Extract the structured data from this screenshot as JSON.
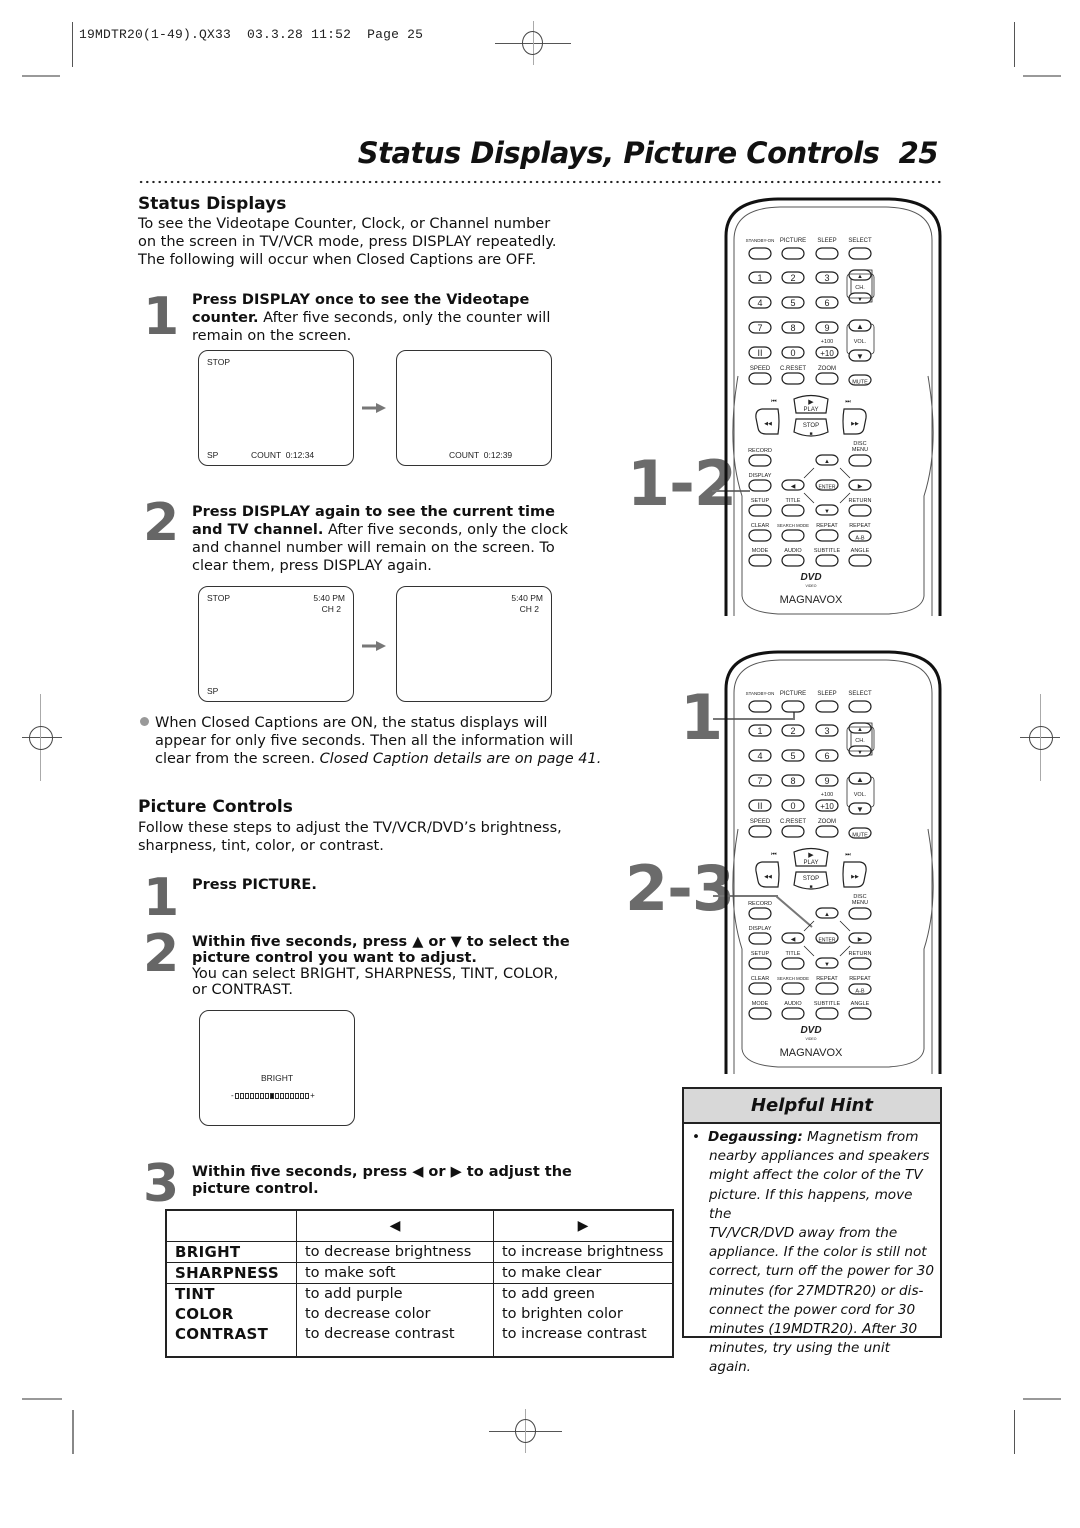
{
  "slug": {
    "file": "19MDTR20(1-49).QX33",
    "date": "03.3.28",
    "time": "11:52",
    "page_label": "Page 25"
  },
  "page_title": "Status Displays, Picture Controls",
  "page_number": "25",
  "status_displays": {
    "heading": "Status Displays",
    "intro": [
      "To see the Videotape Counter, Clock, or Channel number",
      "on the screen in TV/VCR mode, press DISPLAY repeatedly.",
      "The following will occur when Closed Captions are OFF."
    ],
    "step1": {
      "number": "1",
      "bold": "Press DISPLAY once to see the Videotape",
      "bold2": "counter.",
      "text": " After five seconds, only the counter will",
      "text2": "remain on the screen."
    },
    "screens1": {
      "before": {
        "top_left": "STOP",
        "bottom_left": "SP",
        "bottom_center": "COUNT  0:12:34"
      },
      "after": {
        "bottom_center": "COUNT  0:12:39"
      }
    },
    "step2": {
      "number": "2",
      "bold": "Press DISPLAY again to see the current time",
      "bold2": "and TV channel.",
      "text": " After five seconds, only the clock",
      "text2": "and channel number will remain on the screen. To",
      "text3": "clear them, press DISPLAY again."
    },
    "screens2": {
      "before": {
        "top_left": "STOP",
        "time": "5:40 PM",
        "channel": "CH 2",
        "bottom_left": "SP"
      },
      "after": {
        "time": "5:40 PM",
        "channel": "CH 2"
      }
    },
    "note": {
      "line1": "When Closed Captions are ON, the status displays will",
      "line2": "appear for only five seconds. Then all the information will",
      "line3": "clear from the screen. ",
      "italic": "Closed Caption details are on page 41."
    }
  },
  "picture_controls": {
    "heading": "Picture Controls",
    "intro": [
      "Follow these steps to adjust the TV/VCR/DVD’s brightness,",
      "sharpness, tint, color, or contrast."
    ],
    "step1": {
      "number": "1",
      "bold": "Press PICTURE."
    },
    "step2": {
      "number": "2",
      "bold": "Within five seconds, press ▲ or ▼ to select the",
      "bold2": "picture control you want to adjust.",
      "text": "You can select BRIGHT, SHARPNESS, TINT, COLOR,",
      "text2": "or CONTRAST."
    },
    "screen": {
      "label": "BRIGHT",
      "bar": "-▯▯▯▯▯▯▯■▯▯▯▯▯▯▯+",
      "level_fraction": 0.5
    },
    "step3": {
      "number": "3",
      "bold": "Within five seconds, press ◀ or ▶ to adjust the",
      "bold2": "picture control."
    },
    "table": {
      "headers": [
        "",
        "◀",
        "▶"
      ],
      "rows": [
        [
          "BRIGHT",
          "to decrease brightness",
          "to increase brightness"
        ],
        [
          "SHARPNESS",
          "to make soft",
          "to make clear"
        ],
        [
          "TINT",
          "to add purple",
          "to add green"
        ],
        [
          "COLOR",
          "to decrease color",
          "to brighten color"
        ],
        [
          "CONTRAST",
          "to decrease contrast",
          "to increase contrast"
        ]
      ]
    }
  },
  "remote_callouts": {
    "top": "1-2",
    "middle": "1",
    "bottom": "2-3"
  },
  "remote": {
    "top_row_labels": [
      "STANDBY-ON",
      "PICTURE",
      "SLEEP",
      "SELECT"
    ],
    "digits": [
      "1",
      "2",
      "3",
      "4",
      "5",
      "6",
      "7",
      "8",
      "9",
      "II",
      "0",
      "+10"
    ],
    "plus100": "+100",
    "ch_label": "CH.",
    "vol_label": "VOL.",
    "row_labels": [
      "SPEED",
      "C.RESET",
      "ZOOM"
    ],
    "mute": "MUTE",
    "play": "PLAY",
    "stop": "STOP",
    "record": "RECORD",
    "disc_menu": [
      "DISC",
      "MENU"
    ],
    "display": "DISPLAY",
    "enter": "ENTER",
    "setup": "SETUP",
    "title": "TITLE",
    "return": "RETURN",
    "row4_labels": [
      "CLEAR",
      "SEARCH MODE",
      "REPEAT",
      "REPEAT"
    ],
    "ab": "A-B",
    "row5_labels": [
      "MODE",
      "AUDIO",
      "SUBTITLE",
      "ANGLE"
    ],
    "dvd_logo": "DVD",
    "dvd_sub": "VIDEO",
    "brand": "MAGNAVOX"
  },
  "hint": {
    "title": "Helpful Hint",
    "bold": "Degaussing:",
    "lines": [
      " Magnetism from",
      "nearby appliances and speakers",
      "might affect the color of the TV",
      "picture. If this happens, move the",
      "TV/VCR/DVD away from the",
      "appliance. If the color is still not",
      "correct, turn off the power for 30",
      "minutes (for 27MDTR20) or dis-",
      "connect the power cord for 30",
      "minutes (19MDTR20). After 30",
      "minutes, try using the unit again."
    ]
  }
}
